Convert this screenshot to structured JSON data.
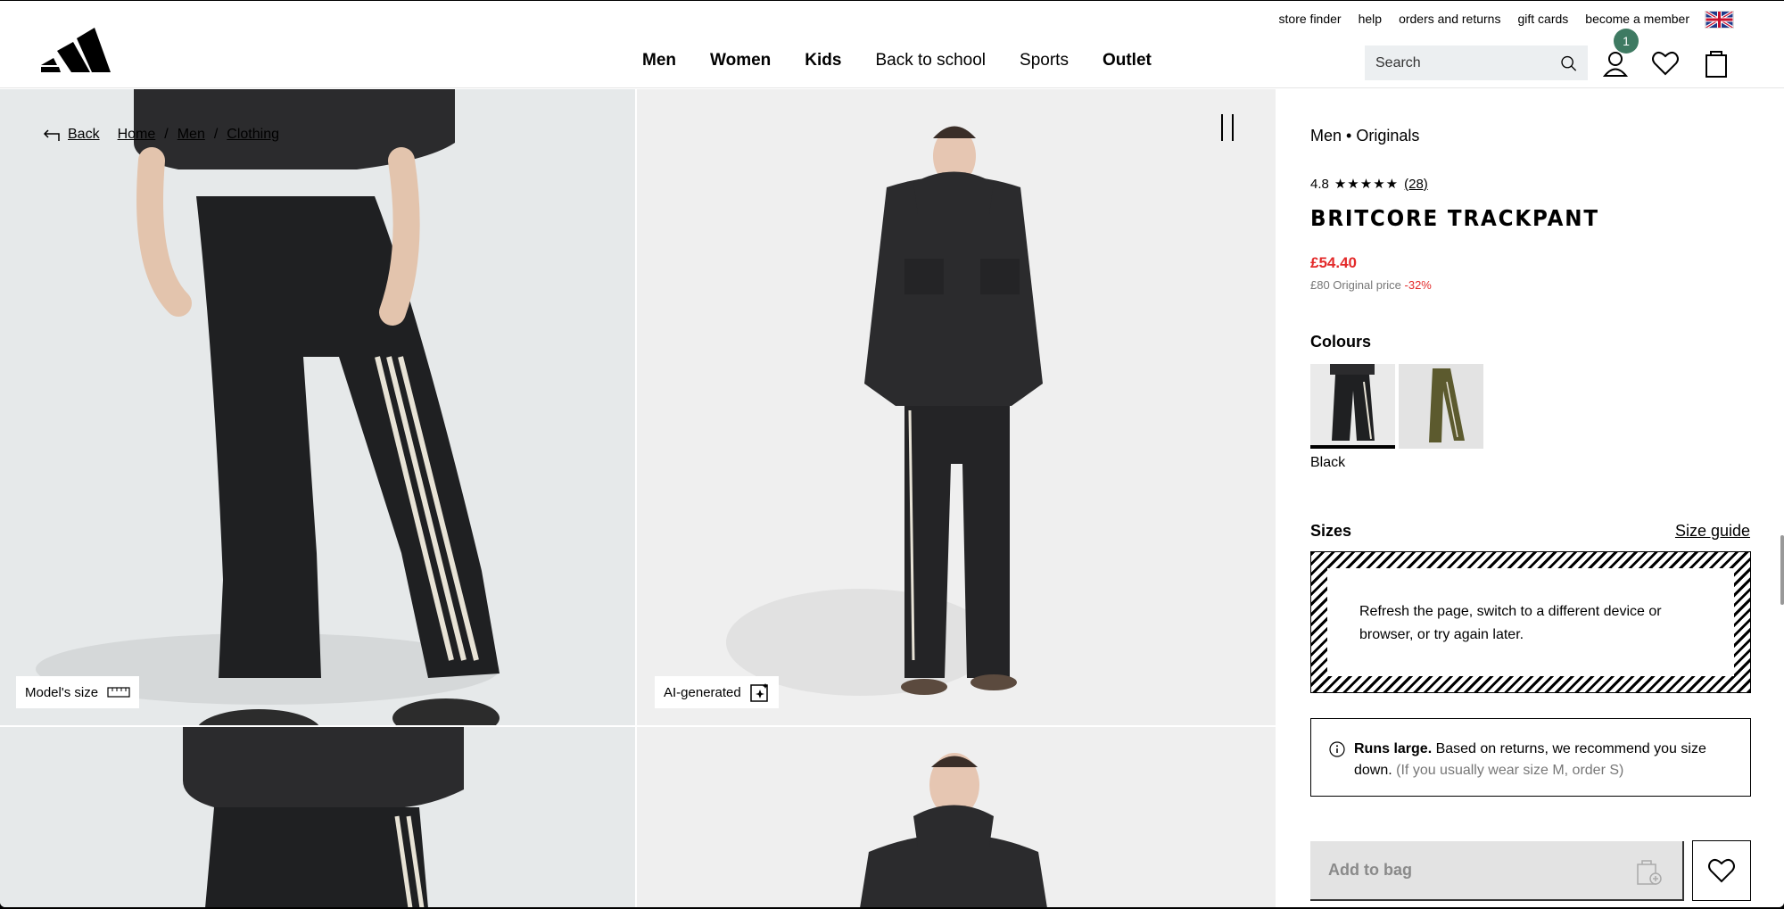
{
  "header": {
    "utility_links": [
      "store finder",
      "help",
      "orders and returns",
      "gift cards",
      "become a member"
    ],
    "nav": [
      {
        "label": "Men",
        "bold": true
      },
      {
        "label": "Women",
        "bold": true
      },
      {
        "label": "Kids",
        "bold": true
      },
      {
        "label": "Back to school",
        "bold": false
      },
      {
        "label": "Sports",
        "bold": false
      },
      {
        "label": "Outlet",
        "bold": true
      }
    ],
    "search_placeholder": "Search",
    "account_badge": "1"
  },
  "gallery": {
    "back_label": "Back",
    "breadcrumbs": [
      "Home",
      "Men",
      "Clothing"
    ],
    "model_size_label": "Model's size",
    "ai_label": "AI-generated"
  },
  "product": {
    "category": "Men • Originals",
    "rating": "4.8",
    "stars": "★★★★★",
    "review_count": "(28)",
    "title": "BRITCORE TRACKPANT",
    "price": "£54.40",
    "original_price": "£80 Original price",
    "discount": "-32%",
    "colours_heading": "Colours",
    "colour_selected": "Black",
    "sizes_heading": "Sizes",
    "size_guide": "Size guide",
    "size_error": "Refresh the page, switch to a different device or browser, or try again later.",
    "runs_bold": "Runs large.",
    "runs_text": " Based on returns, we recommend you size down.",
    "runs_hint": " (If you usually wear size M, order S)",
    "add_to_bag": "Add to bag"
  },
  "colors": {
    "sale_red": "#e32b2b",
    "badge_green": "#3e7a62",
    "search_bg": "#eceff1"
  }
}
